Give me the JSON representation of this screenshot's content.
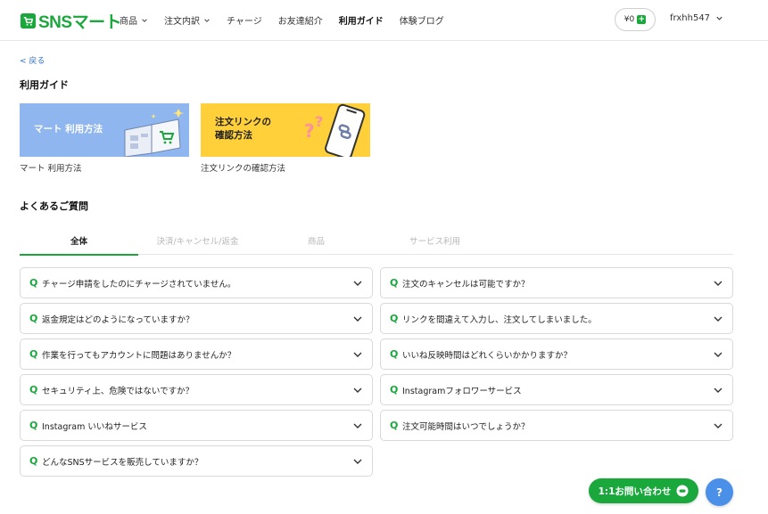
{
  "header": {
    "logo_text": "SNSマート",
    "nav": [
      {
        "label": "商品",
        "has_caret": true
      },
      {
        "label": "注文内訳",
        "has_caret": true
      },
      {
        "label": "チャージ",
        "has_caret": false
      },
      {
        "label": "お友達紹介",
        "has_caret": false
      },
      {
        "label": "利用ガイド",
        "has_caret": false,
        "active": true
      },
      {
        "label": "体験ブログ",
        "has_caret": false
      }
    ],
    "balance": "¥0",
    "balance_add": "+",
    "username": "frxhh547"
  },
  "back_link": "< 戻る",
  "page_title": "利用ガイド",
  "guide_cards": [
    {
      "banner_line1": "マート 利用方法",
      "banner_line2": "",
      "caption": "マート 利用方法"
    },
    {
      "banner_line1": "注文リンクの",
      "banner_line2": "確認方法",
      "caption": "注文リンクの確認方法"
    }
  ],
  "faq_title": "よくあるご質問",
  "faq_tabs": [
    {
      "label": "全体",
      "active": true
    },
    {
      "label": "決済/キャンセル/返金",
      "active": false
    },
    {
      "label": "商品",
      "active": false
    },
    {
      "label": "サービス利用",
      "active": false
    }
  ],
  "faq_marker": "Q",
  "faq_left": [
    "チャージ申請をしたのにチャージされていません。",
    "返金規定はどのようになっていますか？",
    "作業を行ってもアカウントに問題はありませんか？",
    "セキュリティ上、危険ではないですか？",
    "Instagram いいねサービス",
    "どんなSNSサービスを販売していますか？"
  ],
  "faq_right": [
    "注文のキャンセルは可能ですか？",
    "リンクを間違えて入力し、注文してしまいました。",
    "いいね反映時間はどれくらいかかりますか？",
    "Instagramフォロワーサービス",
    "注文可能時間はいつでしょうか？"
  ],
  "contact_button": "1:1お問い合わせ",
  "help_button": "?",
  "colors": {
    "brand_green": "#1aa83c",
    "card_blue": "#8fb6ef",
    "card_yellow": "#ffd03a",
    "help_blue": "#4a8fe8",
    "link_blue": "#2b6fd6"
  }
}
